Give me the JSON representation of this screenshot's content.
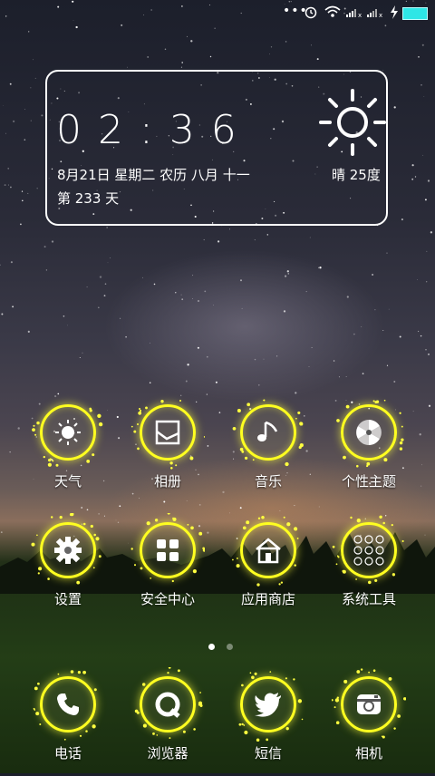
{
  "status_bar": {
    "icons": [
      "more-icon",
      "alarm-icon",
      "wifi-icon",
      "signal-icon",
      "signal-icon",
      "charging-icon",
      "battery-icon"
    ]
  },
  "widget": {
    "time": "02:36",
    "date_line": "8月21日 星期二  农历 八月 十一",
    "day_count": "第 233 天",
    "weather": "晴 25度",
    "weather_icon": "sun-icon"
  },
  "apps": [
    {
      "label": "天气",
      "icon": "sun-icon"
    },
    {
      "label": "相册",
      "icon": "photo-icon"
    },
    {
      "label": "音乐",
      "icon": "music-note-icon"
    },
    {
      "label": "个性主题",
      "icon": "pinwheel-icon"
    },
    {
      "label": "设置",
      "icon": "gear-icon"
    },
    {
      "label": "安全中心",
      "icon": "grid-icon"
    },
    {
      "label": "应用商店",
      "icon": "store-icon"
    },
    {
      "label": "系统工具",
      "icon": "tools-icon"
    }
  ],
  "dock": [
    {
      "label": "电话",
      "icon": "phone-icon"
    },
    {
      "label": "浏览器",
      "icon": "browser-icon"
    },
    {
      "label": "短信",
      "icon": "bird-icon"
    },
    {
      "label": "相机",
      "icon": "camera-icon"
    }
  ],
  "page_indicator": {
    "pages": 2,
    "current": 1
  },
  "colors": {
    "accent": "#ffff20",
    "battery": "#2ee6e6"
  }
}
